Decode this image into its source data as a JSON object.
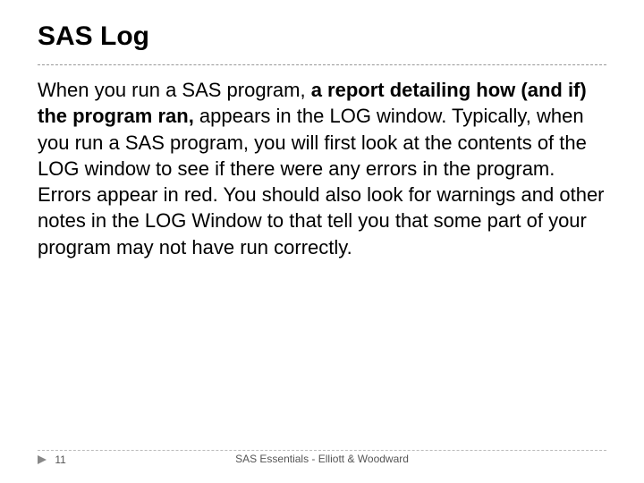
{
  "title": "SAS Log",
  "body": {
    "pre": "When you run a SAS program, ",
    "bold": "a report detailing how (and if) the program ran,",
    "post": "  appears in the LOG window. Typically, when you run a SAS program, you will first look at the contents of the LOG window to see if there were any errors in the program. Errors appear in red. You should also look for warnings and other notes in the LOG Window to that tell you that some part of your program may not have run correctly."
  },
  "footer": {
    "page": "11",
    "center": "SAS Essentials - Elliott & Woodward"
  }
}
